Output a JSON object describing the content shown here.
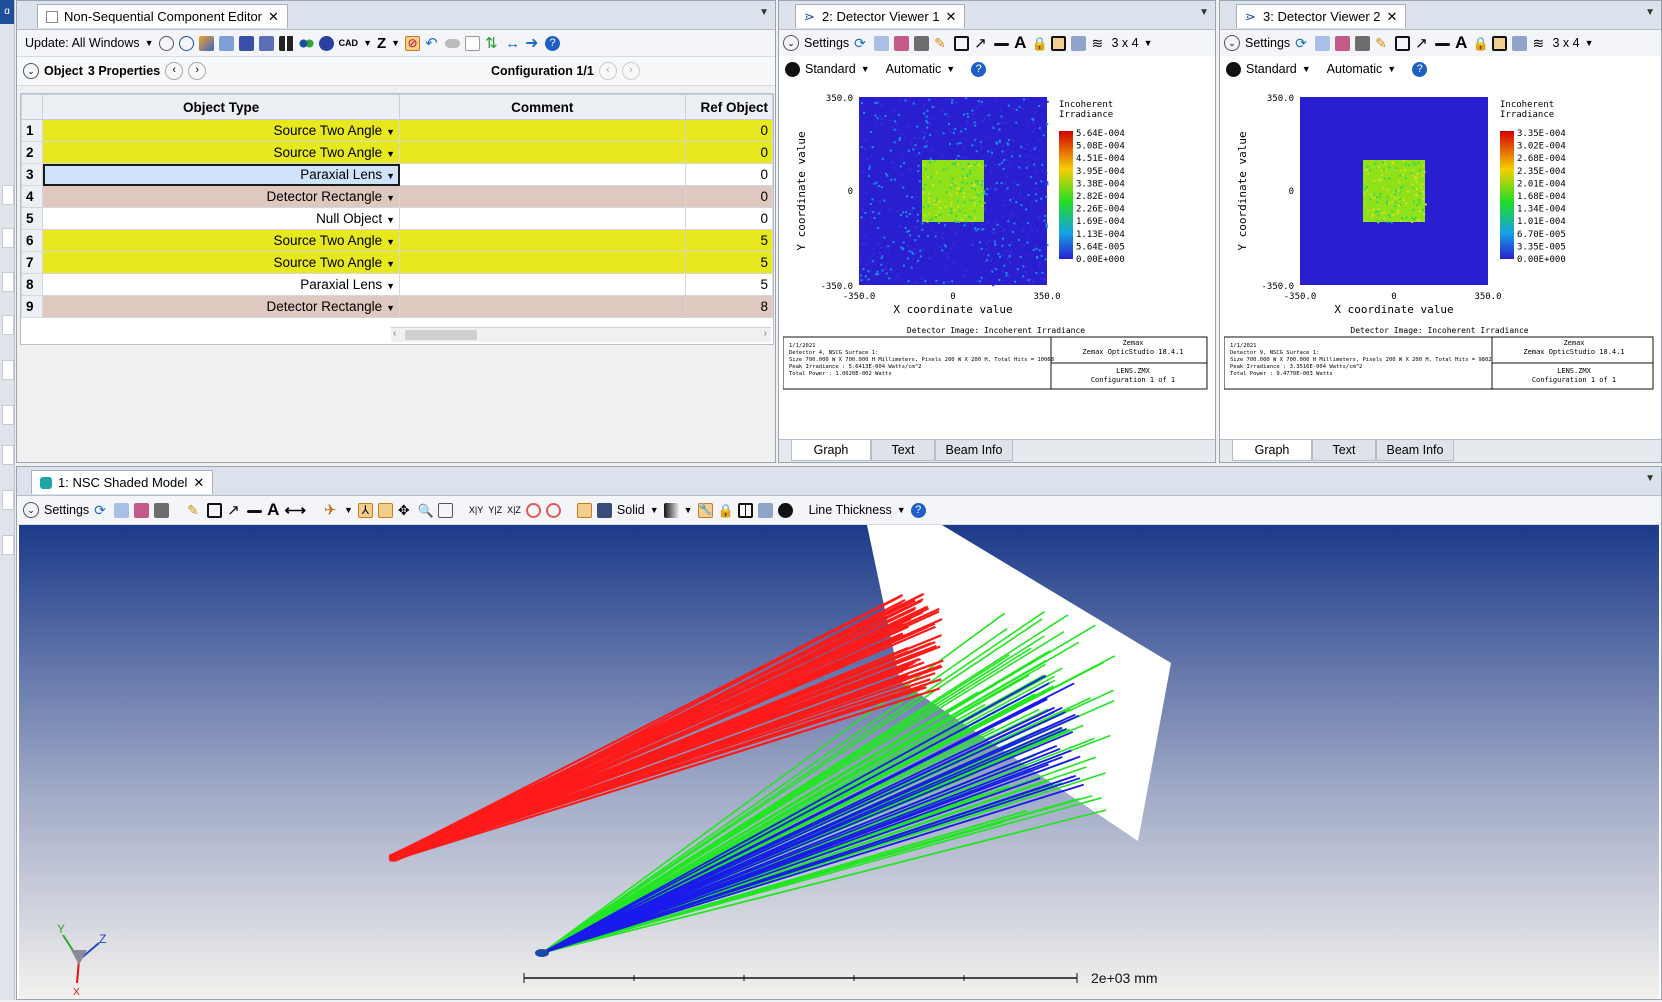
{
  "editor": {
    "tab_title": "Non-Sequential Component Editor",
    "update_label": "Update: All Windows",
    "cad_label": "CAD",
    "z_label": "Z",
    "object_label": "Object",
    "properties_label": "3 Properties",
    "configuration_label": "Configuration 1/1",
    "columns": [
      "Object Type",
      "Comment",
      "Ref Object"
    ],
    "rows": [
      {
        "num": "1",
        "type": "Source Two Angle",
        "comment": "",
        "ref": "0",
        "color": "yellow"
      },
      {
        "num": "2",
        "type": "Source Two Angle",
        "comment": "",
        "ref": "0",
        "color": "yellow"
      },
      {
        "num": "3",
        "type": "Paraxial Lens",
        "comment": "",
        "ref": "0",
        "color": "selected"
      },
      {
        "num": "4",
        "type": "Detector Rectangle",
        "comment": "",
        "ref": "0",
        "color": "pink"
      },
      {
        "num": "5",
        "type": "Null Object",
        "comment": "",
        "ref": "0",
        "color": "white"
      },
      {
        "num": "6",
        "type": "Source Two Angle",
        "comment": "",
        "ref": "5",
        "color": "yellow"
      },
      {
        "num": "7",
        "type": "Source Two Angle",
        "comment": "",
        "ref": "5",
        "color": "yellow"
      },
      {
        "num": "8",
        "type": "Paraxial Lens",
        "comment": "",
        "ref": "5",
        "color": "white"
      },
      {
        "num": "9",
        "type": "Detector Rectangle",
        "comment": "",
        "ref": "8",
        "color": "pink"
      }
    ]
  },
  "viewer1": {
    "tab_title": "2: Detector Viewer 1",
    "settings_label": "Settings",
    "layout_label": "3 x 4",
    "standard_label": "Standard",
    "automatic_label": "Automatic",
    "y_axis_label": "Y coordinate value",
    "x_axis_label": "X coordinate value",
    "y_ticks": [
      "350.0",
      "0",
      "-350.0"
    ],
    "x_ticks": [
      "-350.0",
      "0",
      "350.0"
    ],
    "legend_title_1": "Incoherent",
    "legend_title_2": "Irradiance",
    "legend_values": [
      "5.64E-004",
      "5.08E-004",
      "4.51E-004",
      "3.95E-004",
      "3.38E-004",
      "2.82E-004",
      "2.26E-004",
      "1.69E-004",
      "1.13E-004",
      "5.64E-005",
      "0.00E+000"
    ],
    "footer_title": "Detector Image: Incoherent Irradiance",
    "info_lines": [
      "1/1/2021",
      "Detector 4, NSCG Surface 1:",
      "Size 700.000 W X 700.000 H Millimeters, Pixels 200 W X 200 H, Total Hits = 10068",
      "Peak Irradiance : 5.6413E-004 Watts/cm^2",
      "Total Power     : 1.0020E-002 Watts"
    ],
    "product_lines": [
      "Zemax",
      "Zemax OpticStudio 18.4.1"
    ],
    "file_lines": [
      "LENS.ZMX",
      "Configuration 1 of 1"
    ],
    "tabs": [
      "Graph",
      "Text",
      "Beam Info"
    ]
  },
  "viewer2": {
    "tab_title": "3: Detector Viewer 2",
    "settings_label": "Settings",
    "layout_label": "3 x 4",
    "standard_label": "Standard",
    "automatic_label": "Automatic",
    "y_axis_label": "Y coordinate value",
    "x_axis_label": "X coordinate value",
    "y_ticks": [
      "350.0",
      "0",
      "-350.0"
    ],
    "x_ticks": [
      "-350.0",
      "0",
      "350.0"
    ],
    "legend_title_1": "Incoherent",
    "legend_title_2": "Irradiance",
    "legend_values": [
      "3.35E-004",
      "3.02E-004",
      "2.68E-004",
      "2.35E-004",
      "2.01E-004",
      "1.68E-004",
      "1.34E-004",
      "1.01E-004",
      "6.70E-005",
      "3.35E-005",
      "0.00E+000"
    ],
    "footer_title": "Detector Image: Incoherent Irradiance",
    "info_lines": [
      "1/1/2021",
      "Detector 9, NSCG Surface 1:",
      "Size 700.000 W X 700.000 H Millimeters, Pixels 200 W X 200 H, Total Hits = 9802",
      "Peak Irradiance : 3.3516E-004 Watts/cm^2",
      "Total Power     : 9.4770E-003 Watts"
    ],
    "product_lines": [
      "Zemax",
      "Zemax OpticStudio 18.4.1"
    ],
    "file_lines": [
      "LENS.ZMX",
      "Configuration 1 of 1"
    ],
    "tabs": [
      "Graph",
      "Text",
      "Beam Info"
    ]
  },
  "model": {
    "tab_title": "1: NSC Shaded Model",
    "settings_label": "Settings",
    "solid_label": "Solid",
    "line_thickness_label": "Line Thickness",
    "xy_label": "X|Y",
    "yz_label": "Y|Z",
    "xz_label": "X|Z",
    "scale_label": "2e+03 mm",
    "axis_y": "Y",
    "axis_z": "Z",
    "axis_x": "X"
  },
  "colors": {
    "accent": "#1f4e9b",
    "source_rows": "#e8e81e",
    "detector_rows": "#dfc8bf",
    "ray_red": "#ff1a1a",
    "ray_green": "#22e622",
    "ray_blue": "#1a1aee",
    "scene_top": "#1c3a8a",
    "scene_bottom": "#f4f2ee"
  }
}
